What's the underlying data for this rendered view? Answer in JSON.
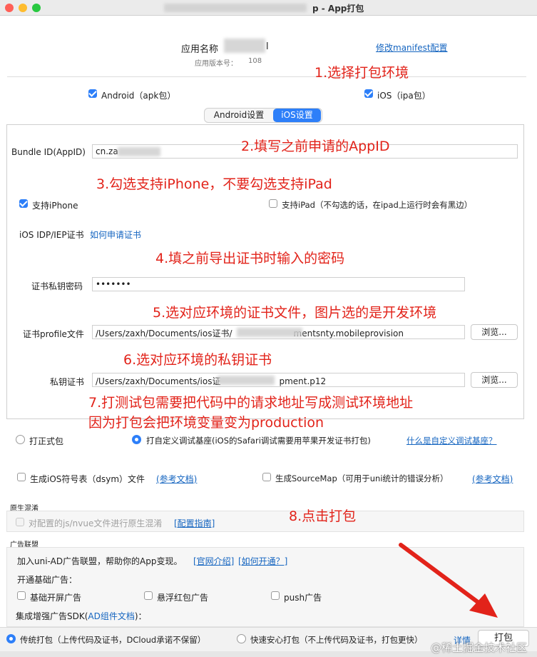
{
  "window": {
    "title": "p - App打包"
  },
  "header": {
    "app_name_label": "应用名称",
    "app_name_tail": "l",
    "version_label": "应用版本号：",
    "version_tail": "108",
    "edit_manifest_link": "修改manifest配置"
  },
  "platforms": {
    "android_label": "Android（apk包）",
    "ios_label": "iOS（ipa包）"
  },
  "tabs": {
    "android_settings": "Android设置",
    "ios_settings": "iOS设置"
  },
  "ios": {
    "bundle_label": "Bundle ID(AppID)",
    "bundle_value": "cn.za",
    "support_iphone_label": "支持iPhone",
    "support_ipad_label": "支持iPad（不勾选的话，在ipad上运行时会有黑边）",
    "idp_label": "iOS IDP/IEP证书",
    "how_to_apply_link": "如何申请证书",
    "cert_password_label": "证书私钥密码",
    "cert_password_value": "•••••••",
    "profile_label": "证书profile文件",
    "profile_value_prefix": "/Users/zaxh/Documents/ios证书/",
    "profile_value_suffix": "mentsnty.mobileprovision",
    "browse_label": "浏览...",
    "private_key_label": "私钥证书",
    "private_key_prefix": "/Users/zaxh/Documents/ios证",
    "private_key_suffix": "pment.p12"
  },
  "build_type": {
    "formal_label": "打正式包",
    "custom_label": "打自定义调试基座(iOS的Safari调试需要用苹果开发证书打包)",
    "what_is_custom_link": "什么是自定义调试基座？"
  },
  "options": {
    "dsym_label": "生成iOS符号表（dsym）文件",
    "dsym_ref_link": "(参考文档)",
    "sourcemap_label": "生成SourceMap（可用于uni统计的错误分析）",
    "sourcemap_ref_link": "(参考文档)"
  },
  "obfuscation": {
    "section_title": "原生混淆",
    "checkbox_label": "对配置的js/nvue文件进行原生混淆",
    "config_guide_link": "[配置指南]"
  },
  "ads": {
    "section_title": "广告联盟",
    "join_text": "加入uni-AD广告联盟，帮助你的App变现。",
    "intro_link": "[官网介绍]",
    "how_to_link": "[如何开通？]",
    "basic_title": "开通基础广告：",
    "splash_label": "基础开屏广告",
    "float_red_label": "悬浮红包广告",
    "push_label": "push广告",
    "enhanced_prefix": "集成增强广告SDK(",
    "enhanced_link": "AD组件文档",
    "enhanced_suffix": ")："
  },
  "footer": {
    "traditional_label": "传统打包（上传代码及证书，DCloud承诺不保留）",
    "fast_label": "快速安心打包（不上传代码及证书，打包更快）",
    "details_link": "详情",
    "build_button": "打包",
    "watermark": "@稀土掘金技术社区"
  },
  "annotations": {
    "step1": "1.选择打包环境",
    "step2": "2.填写之前申请的AppID",
    "step3": "3.勾选支持iPhone，不要勾选支持iPad",
    "step4": "4.填之前导出证书时输入的密码",
    "step5": "5.选对应环境的证书文件，图片选的是开发环境",
    "step6": "6.选对应环境的私钥证书",
    "step7_line1": "7.打测试包需要把代码中的请求地址写成测试环境地址",
    "step7_line2": "因为打包会把环境变量变为production",
    "step8": "8.点击打包"
  },
  "colors": {
    "accent": "#2d7ff9",
    "annotation": "#e2231a",
    "link": "#1565c0"
  }
}
